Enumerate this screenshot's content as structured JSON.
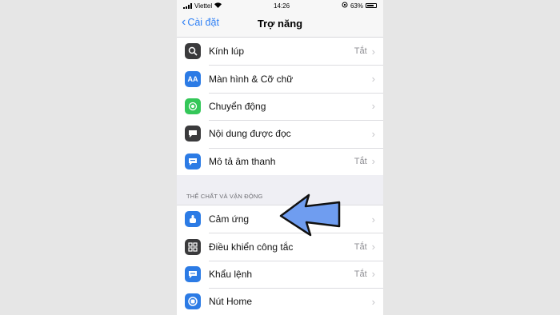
{
  "status": {
    "carrier": "Viettel",
    "time": "14:26",
    "battery": "63%"
  },
  "nav": {
    "back_label": "Cài đặt",
    "title": "Trợ năng"
  },
  "vision_items": [
    {
      "label": "Kính lúp",
      "value": "Tắt",
      "icon": "magnifier-icon",
      "color": "#3a3a3c"
    },
    {
      "label": "Màn hình & Cỡ chữ",
      "value": "",
      "icon": "text-size-icon",
      "color": "#2c7be5"
    },
    {
      "label": "Chuyển động",
      "value": "",
      "icon": "motion-icon",
      "color": "#34c759"
    },
    {
      "label": "Nội dung được đọc",
      "value": "",
      "icon": "speech-icon",
      "color": "#3a3a3c"
    },
    {
      "label": "Mô tả âm thanh",
      "value": "Tắt",
      "icon": "audio-description-icon",
      "color": "#2c7be5"
    }
  ],
  "section_header": "THỂ CHẤT VÀ VẬN ĐỘNG",
  "physical_items": [
    {
      "label": "Cảm ứng",
      "value": "",
      "icon": "touch-icon",
      "color": "#2c7be5"
    },
    {
      "label": "Điều khiển công tắc",
      "value": "Tắt",
      "icon": "switch-control-icon",
      "color": "#3a3a3c"
    },
    {
      "label": "Khẩu lệnh",
      "value": "Tắt",
      "icon": "voice-control-icon",
      "color": "#2c7be5"
    },
    {
      "label": "Nút Home",
      "value": "",
      "icon": "home-button-icon",
      "color": "#2c7be5"
    }
  ],
  "annotation": {
    "arrow_color": "#6f9df0"
  }
}
